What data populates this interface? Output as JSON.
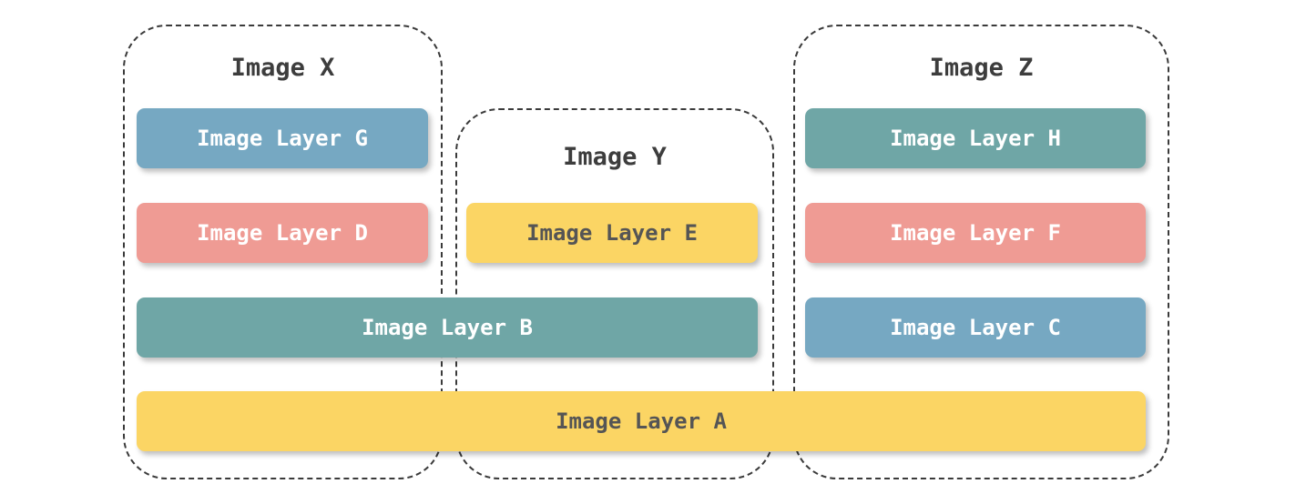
{
  "images": [
    {
      "id": "x",
      "title": "Image X"
    },
    {
      "id": "y",
      "title": "Image Y"
    },
    {
      "id": "z",
      "title": "Image Z"
    }
  ],
  "layers": {
    "g": {
      "label": "Image Layer G",
      "color": "#76a8c2"
    },
    "d": {
      "label": "Image Layer D",
      "color": "#ef9b94"
    },
    "e": {
      "label": "Image Layer E",
      "color": "#fbd564"
    },
    "b": {
      "label": "Image Layer B",
      "color": "#6fa6a6"
    },
    "h": {
      "label": "Image Layer H",
      "color": "#6fa6a6"
    },
    "f": {
      "label": "Image Layer F",
      "color": "#ef9b94"
    },
    "c": {
      "label": "Image Layer C",
      "color": "#76a8c2"
    },
    "a": {
      "label": "Image Layer A",
      "color": "#fbd564"
    }
  }
}
